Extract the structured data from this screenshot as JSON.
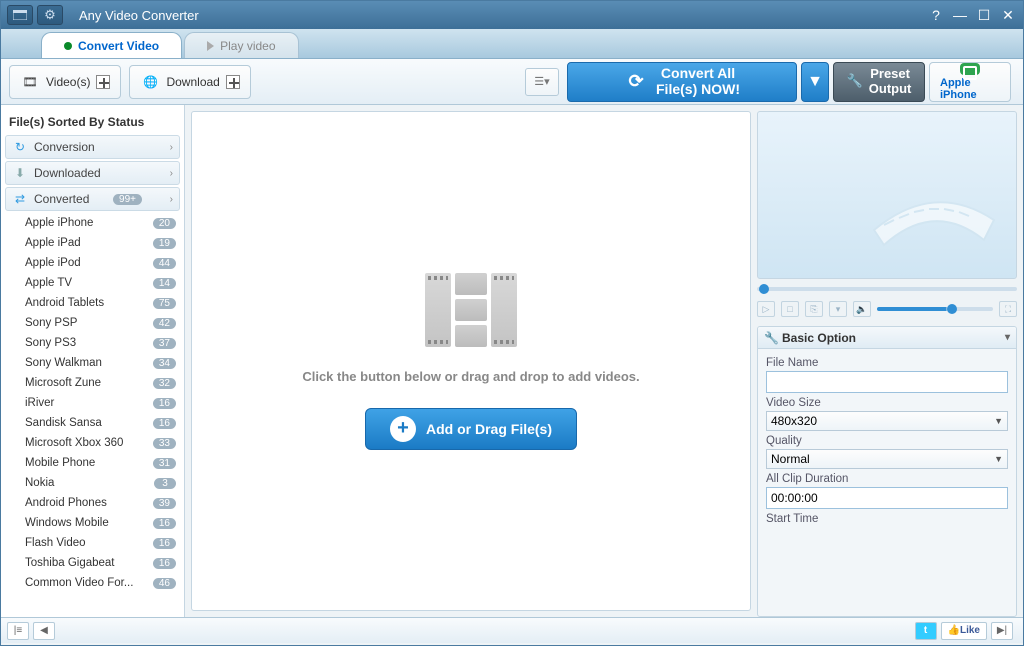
{
  "title": "Any Video Converter",
  "tabs": {
    "convert": "Convert Video",
    "play": "Play video"
  },
  "toolbar": {
    "videos": "Video(s)",
    "download": "Download"
  },
  "actions": {
    "convert_all_l1": "Convert All",
    "convert_all_l2": "File(s) NOW!",
    "preset_l1": "Preset",
    "preset_l2": "Output",
    "device": "Apple iPhone"
  },
  "sidebar": {
    "header": "File(s) Sorted By Status",
    "cat_conversion": "Conversion",
    "cat_downloaded": "Downloaded",
    "cat_converted": "Converted",
    "cat_converted_badge": "99+",
    "devices": [
      {
        "name": "Apple iPhone",
        "count": "20"
      },
      {
        "name": "Apple iPad",
        "count": "19"
      },
      {
        "name": "Apple iPod",
        "count": "44"
      },
      {
        "name": "Apple TV",
        "count": "14"
      },
      {
        "name": "Android Tablets",
        "count": "75"
      },
      {
        "name": "Sony PSP",
        "count": "42"
      },
      {
        "name": "Sony PS3",
        "count": "37"
      },
      {
        "name": "Sony Walkman",
        "count": "34"
      },
      {
        "name": "Microsoft Zune",
        "count": "32"
      },
      {
        "name": "iRiver",
        "count": "16"
      },
      {
        "name": "Sandisk Sansa",
        "count": "16"
      },
      {
        "name": "Microsoft Xbox 360",
        "count": "33"
      },
      {
        "name": "Mobile Phone",
        "count": "31"
      },
      {
        "name": "Nokia",
        "count": "3"
      },
      {
        "name": "Android Phones",
        "count": "39"
      },
      {
        "name": "Windows Mobile",
        "count": "16"
      },
      {
        "name": "Flash Video",
        "count": "16"
      },
      {
        "name": "Toshiba Gigabeat",
        "count": "16"
      },
      {
        "name": "Common Video For...",
        "count": "46"
      }
    ]
  },
  "center": {
    "hint": "Click the button below or drag and drop to add videos.",
    "addbtn": "Add or Drag File(s)"
  },
  "options": {
    "title": "Basic Option",
    "file_name_label": "File Name",
    "file_name_value": "",
    "video_size_label": "Video Size",
    "video_size_value": "480x320",
    "quality_label": "Quality",
    "quality_value": "Normal",
    "duration_label": "All Clip Duration",
    "duration_value": "00:00:00",
    "start_label": "Start Time"
  },
  "status": {
    "like": "Like"
  }
}
